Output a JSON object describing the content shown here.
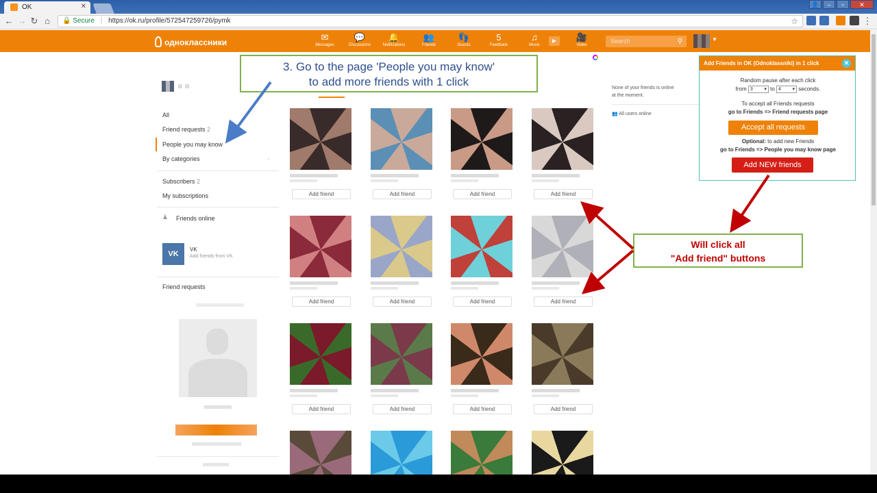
{
  "browser": {
    "tab_title": "OK",
    "tab_close": "✕",
    "secure_label": "Secure",
    "url": "https://ok.ru/profile/572547259726/pymk"
  },
  "header": {
    "logo": "одноклассники",
    "nav": [
      {
        "label": "Messages",
        "icon": "✉"
      },
      {
        "label": "Discussions",
        "icon": "💬"
      },
      {
        "label": "Notifications",
        "icon": "🔔"
      },
      {
        "label": "Friends",
        "icon": "👥"
      },
      {
        "label": "Guests",
        "icon": "👣"
      },
      {
        "label": "Feedback",
        "icon": "5"
      },
      {
        "label": "Music",
        "icon": "♫"
      },
      {
        "label": "Video",
        "icon": "🎥"
      }
    ],
    "search_placeholder": "Search"
  },
  "sidebar": {
    "all": "All",
    "friend_requests": "Friend requests",
    "friend_requests_count": "2",
    "people_you_may_know": "People you may know",
    "by_categories": "By categories",
    "subscribers": "Subscribers",
    "subscribers_count": "2",
    "my_subscriptions": "My subscriptions",
    "friends_online": "Friends online",
    "vk_title": "VK",
    "vk_sub": "Add friends from VK",
    "friend_requests_2": "Friend requests"
  },
  "grid": {
    "add_label": "Add friend",
    "cards": [
      {
        "c1": "#3a2b2b",
        "c2": "#a07a6a"
      },
      {
        "c1": "#c9a99a",
        "c2": "#5b8fb5"
      },
      {
        "c1": "#1f1a1a",
        "c2": "#c99a85"
      },
      {
        "c1": "#2a2222",
        "c2": "#d9c9c0"
      },
      {
        "c1": "#8a2a3a",
        "c2": "#d08080"
      },
      {
        "c1": "#d9c98a",
        "c2": "#9aa6c8"
      },
      {
        "c1": "#6ed0d8",
        "c2": "#c0403a"
      },
      {
        "c1": "#b0b0b8",
        "c2": "#d8d8d8"
      },
      {
        "c1": "#7a1a2a",
        "c2": "#3a6a2a"
      },
      {
        "c1": "#7a3a4a",
        "c2": "#5a7a4a"
      },
      {
        "c1": "#3a2a1a",
        "c2": "#d0886a"
      },
      {
        "c1": "#8a7a5a",
        "c2": "#4a3a2a"
      },
      {
        "c1": "#9a6a7a",
        "c2": "#5a4a3a"
      },
      {
        "c1": "#2a9ad8",
        "c2": "#6acae8"
      },
      {
        "c1": "#3a7a3a",
        "c2": "#c08a5a"
      },
      {
        "c1": "#1a1a1a",
        "c2": "#e8d8a0"
      }
    ]
  },
  "right": {
    "none_online_1": "None of your friends is online",
    "none_online_2": "at the moment.",
    "all_users_online": "All users online"
  },
  "popup": {
    "title": "Add Friends in OK (Odnoklassniki) in 1 click",
    "close": "✕",
    "pause_label": "Random pause after each click",
    "from_label": "from",
    "from_value": "3",
    "to_label": "to",
    "to_value": "4",
    "seconds_label": "seconds.",
    "accept_hint": "To accept all Friends requests",
    "accept_path": "go to Friends => Friend requests page",
    "accept_button": "Accept all requests",
    "optional_bold": "Optional:",
    "optional_text": " to add new Friends",
    "optional_path": "go to Friends => People you may know page",
    "addnew_button": "Add NEW friends"
  },
  "annotations": {
    "step3_line1": "3. Go to the page 'People you may know'",
    "step3_line2": "to add more friends with 1 click",
    "willclick_line1": "Will click all",
    "willclick_line2": "\"Add friend\" buttons"
  },
  "colors": {
    "brand_orange": "#ee8208",
    "accept_orange": "#ee8208",
    "addnew_red": "#d41e16",
    "callout_border": "#7fb149",
    "arrow_blue": "#4a7cc7",
    "arrow_red": "#c00000"
  }
}
